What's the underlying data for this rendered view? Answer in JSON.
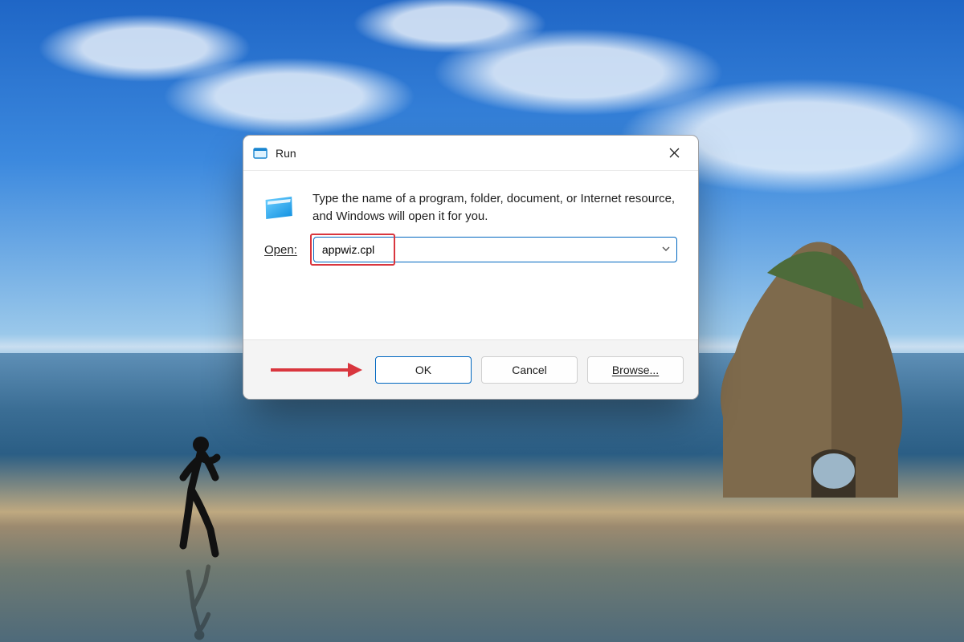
{
  "dialog": {
    "title": "Run",
    "description": "Type the name of a program, folder, document, or Internet resource, and Windows will open it for you.",
    "open_label": "Open:",
    "open_value": "appwiz.cpl",
    "buttons": {
      "ok": "OK",
      "cancel": "Cancel",
      "browse": "Browse..."
    }
  },
  "annotations": {
    "arrow_color": "#d9363e",
    "highlight_color": "#d9363e"
  }
}
